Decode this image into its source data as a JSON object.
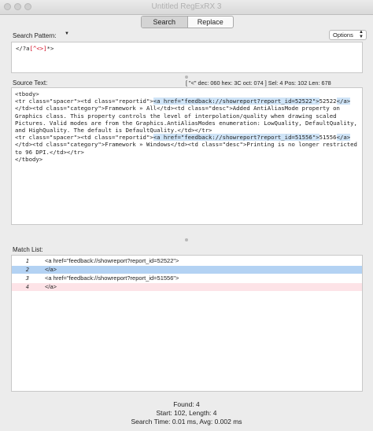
{
  "window": {
    "title": "Untitled RegExRX 3"
  },
  "mode_tabs": {
    "search": "Search",
    "replace": "Replace"
  },
  "search_pattern": {
    "label": "Search Pattern:",
    "menu_glyph": "▼",
    "value_prefix": "</?a",
    "value_class": "[^<>]",
    "value_suffix": "*>"
  },
  "options": {
    "label": "Options"
  },
  "source": {
    "label": "Source Text:",
    "info": "[ \"<\" dec: 060 hex: 3C oct: 074 ] Sel: 4 Pos: 102 Len: 678",
    "segments": [
      {
        "text": "<tbody>\n<tr class=\"spacer\"><td class=\"reportid\">",
        "hl": false
      },
      {
        "text": "<a href=\"feedback://showreport?report_id=52522\">",
        "hl": true
      },
      {
        "text": "52522",
        "hl": false
      },
      {
        "text": "</a>",
        "hl": true
      },
      {
        "text": "</td><td class=\"category\">Framework » All</td><td class=\"desc\">Added AntiAliasMode property on Graphics class. This property controls the level of interpolation/quality when drawing scaled Pictures. Valid modes are from the Graphics.AntiAliasModes enumeration: LowQuality, DefaultQuality, and HighQuality. The default is DefaultQuality.</td></tr>\n<tr class=\"spacer\"><td class=\"reportid\">",
        "hl": false
      },
      {
        "text": "<a href=\"feedback://showreport?report_id=51556\">",
        "hl": true
      },
      {
        "text": "51556",
        "hl": false
      },
      {
        "text": "</a>",
        "hl": true
      },
      {
        "text": "</td><td class=\"category\">Framework » Windows</td><td class=\"desc\">Printing is no longer restricted to 96 DPI.</td></tr>\n</tbody>",
        "hl": false
      }
    ]
  },
  "match_list": {
    "label": "Match List:",
    "rows": [
      {
        "num": "1",
        "text": "<a href=\"feedback://showreport?report_id=52522\">",
        "bg": "#ffffff"
      },
      {
        "num": "2",
        "text": "</a>",
        "bg": "#b3d2f3"
      },
      {
        "num": "3",
        "text": "<a href=\"feedback://showreport?report_id=51556\">",
        "bg": "#ffffff"
      },
      {
        "num": "4",
        "text": "</a>",
        "bg": "#fde3e7"
      }
    ]
  },
  "footer": {
    "found": "Found: 4",
    "start": "Start: 102, Length: 4",
    "time": "Search Time: 0.01 ms, Avg: 0.002 ms"
  }
}
